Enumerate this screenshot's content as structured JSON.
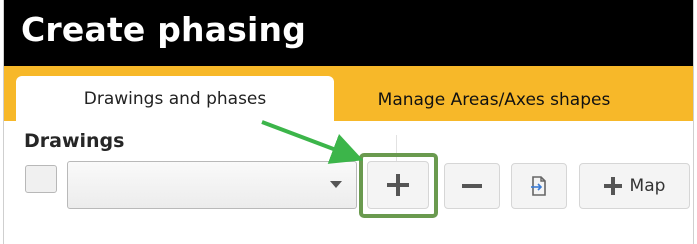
{
  "window": {
    "title": "Create phasing"
  },
  "tabs": [
    {
      "label": "Drawings and phases",
      "active": true
    },
    {
      "label": "Manage Areas/Axes shapes",
      "active": false
    }
  ],
  "drawings": {
    "section_label": "Drawings",
    "dropdown_value": "",
    "checkbox_checked": false
  },
  "toolbar": {
    "add_icon": "plus-icon",
    "remove_icon": "minus-icon",
    "doc_icon": "document-icon",
    "map_icon": "plus-icon",
    "map_label": "Map"
  },
  "colors": {
    "titlebar": "#000000",
    "tabbar": "#f7b829",
    "highlight": "#6a9a4f",
    "arrow": "#3cb54a"
  }
}
